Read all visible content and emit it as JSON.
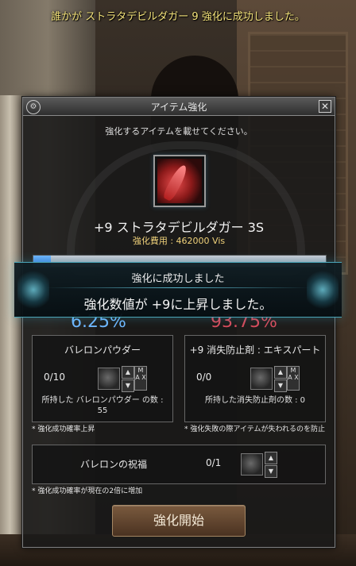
{
  "system_message": "誰かが ストラタデビルダガー 9 強化に成功しました。",
  "window": {
    "title": "アイテム強化",
    "title_icon": "⚙",
    "close_label": "✕"
  },
  "instruction": "強化するアイテムを載せてください。",
  "item": {
    "name": "+9 ストラタデビルダガー 3S",
    "cost_label": "強化費用 : 462000 Vis",
    "icon": "red-dagger-icon"
  },
  "progress": 0.06,
  "rates": {
    "success": "6.25%",
    "failure": "93.75%"
  },
  "banner": {
    "title": "強化に成功しました",
    "message": "強化数値が +9に上昇しました。"
  },
  "left_panel": {
    "title": "バレロンパウダー",
    "count": "0/10",
    "owned": "所持した バレロンパウダー の数 : 55",
    "note": "* 強化成功確率上昇"
  },
  "right_panel": {
    "title": "+9 消失防止剤 : エキスパート",
    "count": "0/0",
    "owned": "所持した消失防止剤の数 : 0",
    "note": "* 強化失敗の際アイテムが失われるのを防止"
  },
  "blessing": {
    "label": "バレロンの祝福",
    "count": "0/1",
    "note": "* 強化成功確率が現在の2倍に増加"
  },
  "controls": {
    "up": "▲",
    "down": "▼",
    "max": "M A X"
  },
  "start_button": "強化開始",
  "colors": {
    "success_rate": "#6fb7ff",
    "failure_rate": "#d84b5b",
    "cost_text": "#f0d27a",
    "banner_accent": "#4aa6b9"
  }
}
